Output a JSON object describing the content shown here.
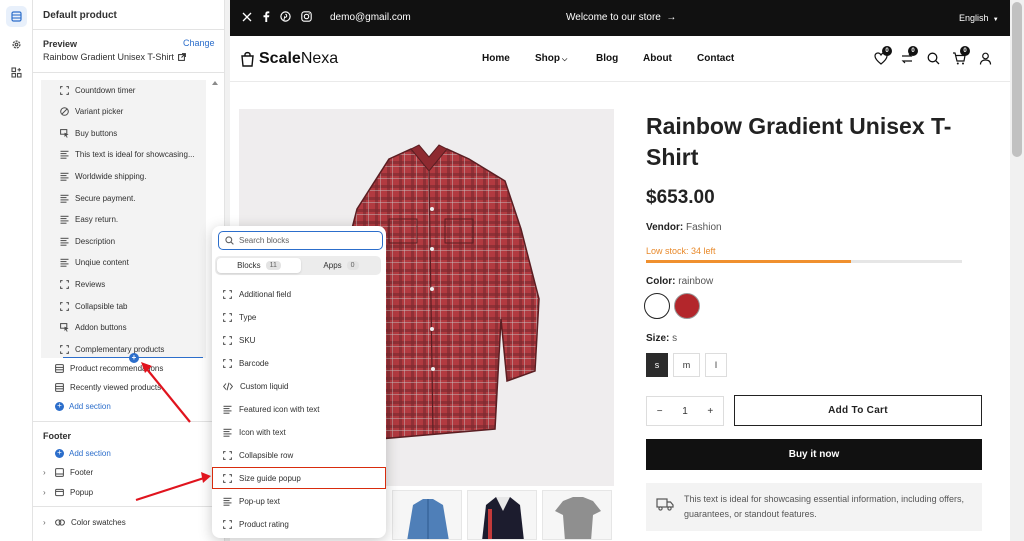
{
  "sidebar": {
    "title": "Default product",
    "preview_label": "Preview",
    "change_label": "Change",
    "preview_value": "Rainbow Gradient Unisex T-Shirt",
    "blocks": [
      {
        "label": "Countdown timer",
        "icon": "block-icon"
      },
      {
        "label": "Variant picker",
        "icon": "variant-icon"
      },
      {
        "label": "Buy buttons",
        "icon": "cursor-icon"
      },
      {
        "label": "This text is ideal for showcasing...",
        "icon": "text-icon"
      },
      {
        "label": "Worldwide shipping.",
        "icon": "text-icon"
      },
      {
        "label": "Secure payment.",
        "icon": "text-icon"
      },
      {
        "label": "Easy return.",
        "icon": "text-icon"
      },
      {
        "label": "Description",
        "icon": "text-icon"
      },
      {
        "label": "Unqiue content",
        "icon": "text-icon"
      },
      {
        "label": "Reviews",
        "icon": "block-icon"
      },
      {
        "label": "Collapsible tab",
        "icon": "block-icon"
      },
      {
        "label": "Addon buttons",
        "icon": "cursor-icon"
      },
      {
        "label": "Complementary products",
        "icon": "block-icon"
      }
    ],
    "sections": [
      {
        "label": "Product recommendations"
      },
      {
        "label": "Recently viewed products"
      }
    ],
    "add_section": "Add section",
    "footer_heading": "Footer",
    "footer_add_section": "Add section",
    "footer_items": [
      {
        "label": "Footer"
      },
      {
        "label": "Popup"
      }
    ],
    "color_swatches": "Color swatches"
  },
  "picker": {
    "search_placeholder": "Search blocks",
    "tabs": [
      {
        "label": "Blocks",
        "count": "11"
      },
      {
        "label": "Apps",
        "count": "0"
      }
    ],
    "items": [
      {
        "label": "Additional field",
        "icon": "block-icon"
      },
      {
        "label": "Type",
        "icon": "block-icon"
      },
      {
        "label": "SKU",
        "icon": "block-icon"
      },
      {
        "label": "Barcode",
        "icon": "block-icon"
      },
      {
        "label": "Custom liquid",
        "icon": "code-icon"
      },
      {
        "label": "Featured icon with text",
        "icon": "text-icon"
      },
      {
        "label": "Icon with text",
        "icon": "text-icon"
      },
      {
        "label": "Collapsible row",
        "icon": "block-icon"
      },
      {
        "label": "Size guide popup",
        "icon": "block-icon"
      },
      {
        "label": "Pop-up text",
        "icon": "text-icon"
      },
      {
        "label": "Product rating",
        "icon": "block-icon"
      }
    ]
  },
  "store": {
    "email": "demo@gmail.com",
    "welcome": "Welcome to our store",
    "language": "English",
    "logo_bold": "Scale",
    "logo_light": "Nexa",
    "nav": [
      "Home",
      "Shop",
      "Blog",
      "About",
      "Contact"
    ],
    "badges": {
      "wishlist": "0",
      "compare": "0",
      "cart": "0"
    },
    "product": {
      "title": "Rainbow Gradient Unisex T-Shirt",
      "price": "$653.00",
      "vendor_label": "Vendor:",
      "vendor": "Fashion",
      "stock": "Low stock: 34 left",
      "stock_fraction": 0.65,
      "color_label": "Color:",
      "color_value": "rainbow",
      "swatch_colors": [
        "#ffffff",
        "#b3262b"
      ],
      "size_label": "Size:",
      "size_value": "s",
      "sizes": [
        "s",
        "m",
        "l"
      ],
      "qty": "1",
      "qty_minus": "−",
      "qty_plus": "+",
      "add_to_cart": "Add To Cart",
      "buy_now": "Buy it now",
      "info_text": "This text is ideal for showcasing essential information, including offers, guarantees, or standout features."
    }
  },
  "colors": {
    "accent": "#2c6ecb",
    "highlight": "#d82c0d",
    "arrow": "#e0141e"
  }
}
